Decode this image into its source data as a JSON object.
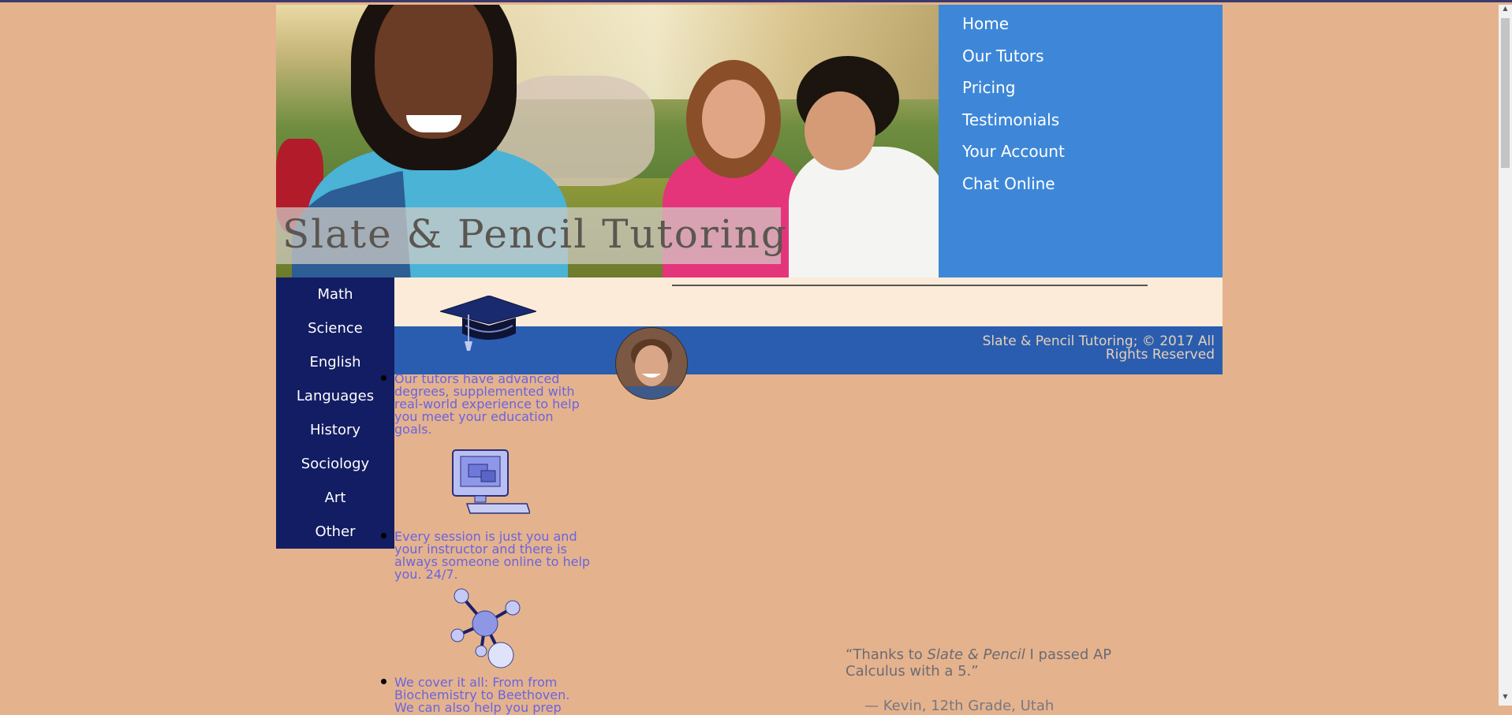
{
  "brand": {
    "hero_title": "Slate & Pencil Tutoring"
  },
  "top_nav": {
    "items": [
      {
        "label": "Home"
      },
      {
        "label": "Our Tutors"
      },
      {
        "label": "Pricing"
      },
      {
        "label": "Testimonials"
      },
      {
        "label": "Your Account"
      },
      {
        "label": "Chat Online"
      }
    ]
  },
  "side_nav": {
    "items": [
      {
        "label": "Math"
      },
      {
        "label": "Science"
      },
      {
        "label": "English"
      },
      {
        "label": "Languages"
      },
      {
        "label": "History"
      },
      {
        "label": "Sociology"
      },
      {
        "label": "Art"
      },
      {
        "label": "Other"
      }
    ]
  },
  "footer": {
    "copyright": "Slate & Pencil Tutoring; © 2017 All Rights Reserved"
  },
  "features": [
    {
      "text": "Our tutors have advanced degrees, supplemented with real-world experience to help you meet your education goals.",
      "icon": "graduation-cap-icon"
    },
    {
      "text": "Every session is just you and your instructor and there is always someone online to help you. 24/7.",
      "icon": "computer-icon"
    },
    {
      "text": "We cover it all: From from Biochemistry to Beethoven. We can also help you prep",
      "icon": "molecule-icon"
    }
  ],
  "testimonial": {
    "quote_prefix": "“Thanks to ",
    "quote_emphasis": "Slate & Pencil",
    "quote_suffix": " I passed AP Calculus with a 5.”",
    "author": "— Kevin, 12th Grade, Utah"
  },
  "colors": {
    "page_bg": "#e4b38d",
    "top_nav_bg": "#3e87d8",
    "side_nav_bg": "#131d63",
    "footer_bg": "#2a5db0",
    "feature_text": "#6b63e0"
  }
}
